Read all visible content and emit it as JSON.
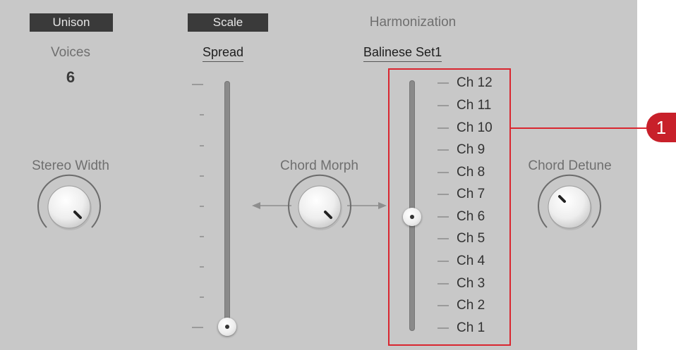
{
  "header": {
    "unison_label": "Unison",
    "scale_label": "Scale",
    "harmonization_label": "Harmonization"
  },
  "voices": {
    "label": "Voices",
    "value": "6"
  },
  "spread": {
    "label": "Spread"
  },
  "scale_set": {
    "label": "Balinese Set1"
  },
  "knobs": {
    "stereo_width": {
      "label": "Stereo Width"
    },
    "chord_morph": {
      "label": "Chord Morph"
    },
    "chord_detune": {
      "label": "Chord Detune"
    }
  },
  "channels": [
    "Ch 12",
    "Ch 11",
    "Ch 10",
    "Ch 9",
    "Ch 8",
    "Ch 7",
    "Ch 6",
    "Ch 5",
    "Ch 4",
    "Ch 3",
    "Ch 2",
    "Ch 1"
  ],
  "callout": {
    "number": "1"
  },
  "colors": {
    "panel": "#c8c8c8",
    "button_bg": "#3a3a3a",
    "accent_red": "#d9262f"
  }
}
